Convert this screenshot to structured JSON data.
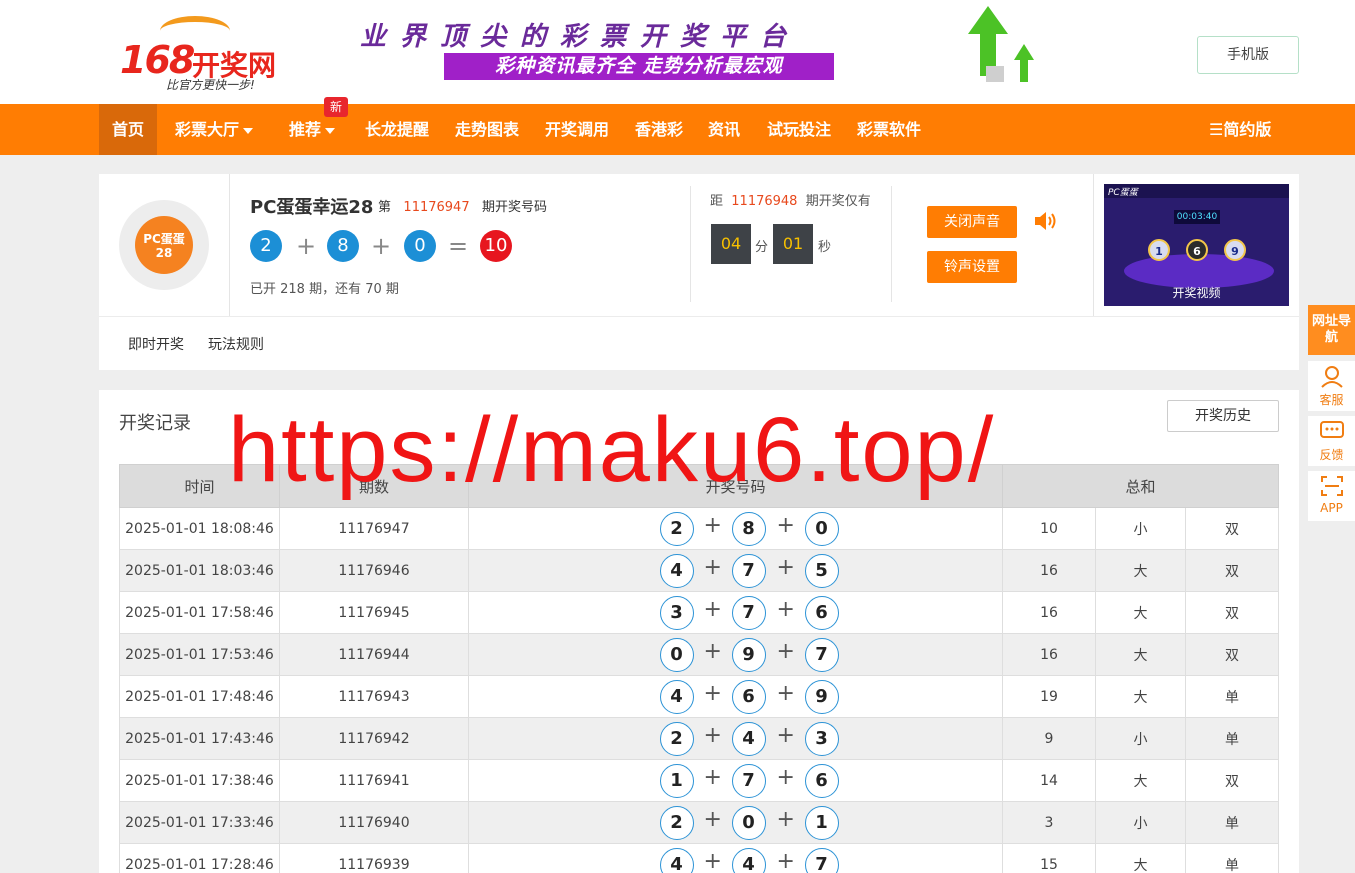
{
  "header": {
    "logo_num": "168",
    "logo_name": "开奖网",
    "logo_slogan": "比官方更快一步!",
    "banner_main": "业界顶尖的彩票开奖平台",
    "banner_sub": "彩种资讯最齐全  走势分析最宏观",
    "mobile_label": "手机版"
  },
  "nav": {
    "items": [
      "首页",
      "彩票大厅",
      "推荐",
      "长龙提醒",
      "走势图表",
      "开奖调用",
      "香港彩",
      "资讯",
      "试玩投注",
      "彩票软件"
    ],
    "new_badge": "新",
    "simple_label": "☰简约版"
  },
  "lottery": {
    "logo_text": "PC蛋蛋 28",
    "name": "PC蛋蛋幸运28",
    "issue_prefix": "第",
    "issue": "11176947",
    "issue_suffix": "期开奖号码",
    "balls": [
      "2",
      "8",
      "0"
    ],
    "sum": "10",
    "plus": "+",
    "equals": "=",
    "opened_text": "已开 218 期，还有 70 期",
    "next_prefix": "距",
    "next_issue": "11176948",
    "next_suffix": "期开奖仅有",
    "countdown_min": "04",
    "min_unit": "分",
    "countdown_sec": "01",
    "sec_unit": "秒",
    "mute_label": "关闭声音",
    "ring_label": "铃声设置",
    "video_brand": "PC蛋蛋",
    "video_time": "00:03:40",
    "video_balls": [
      "1",
      "6",
      "9"
    ],
    "video_caption": "开奖视频",
    "tabs": [
      "即时开奖",
      "玩法规则"
    ]
  },
  "records": {
    "title": "开奖记录",
    "history_label": "开奖历史",
    "headers": [
      "时间",
      "期数",
      "开奖号码",
      "总和"
    ],
    "plus": "+",
    "rows": [
      {
        "time": "2025-01-01 18:08:46",
        "issue": "11176947",
        "balls": [
          "2",
          "8",
          "0"
        ],
        "sum": "10",
        "size": "小",
        "parity": "双"
      },
      {
        "time": "2025-01-01 18:03:46",
        "issue": "11176946",
        "balls": [
          "4",
          "7",
          "5"
        ],
        "sum": "16",
        "size": "大",
        "parity": "双"
      },
      {
        "time": "2025-01-01 17:58:46",
        "issue": "11176945",
        "balls": [
          "3",
          "7",
          "6"
        ],
        "sum": "16",
        "size": "大",
        "parity": "双"
      },
      {
        "time": "2025-01-01 17:53:46",
        "issue": "11176944",
        "balls": [
          "0",
          "9",
          "7"
        ],
        "sum": "16",
        "size": "大",
        "parity": "双"
      },
      {
        "time": "2025-01-01 17:48:46",
        "issue": "11176943",
        "balls": [
          "4",
          "6",
          "9"
        ],
        "sum": "19",
        "size": "大",
        "parity": "单"
      },
      {
        "time": "2025-01-01 17:43:46",
        "issue": "11176942",
        "balls": [
          "2",
          "4",
          "3"
        ],
        "sum": "9",
        "size": "小",
        "parity": "单"
      },
      {
        "time": "2025-01-01 17:38:46",
        "issue": "11176941",
        "balls": [
          "1",
          "7",
          "6"
        ],
        "sum": "14",
        "size": "大",
        "parity": "双"
      },
      {
        "time": "2025-01-01 17:33:46",
        "issue": "11176940",
        "balls": [
          "2",
          "0",
          "1"
        ],
        "sum": "3",
        "size": "小",
        "parity": "单"
      },
      {
        "time": "2025-01-01 17:28:46",
        "issue": "11176939",
        "balls": [
          "4",
          "4",
          "7"
        ],
        "sum": "15",
        "size": "大",
        "parity": "单"
      }
    ]
  },
  "side_widgets": {
    "nav_label": "网址导航",
    "service_label": "客服",
    "feedback_label": "反馈",
    "app_label": "APP"
  },
  "watermark": "https://maku6.top/",
  "colors": {
    "brand_orange": "#ff7d03",
    "ball_blue": "#1c8fd6",
    "ball_red": "#e7161f",
    "big_red": "#e0262b",
    "small_blue": "#1f57c7"
  }
}
